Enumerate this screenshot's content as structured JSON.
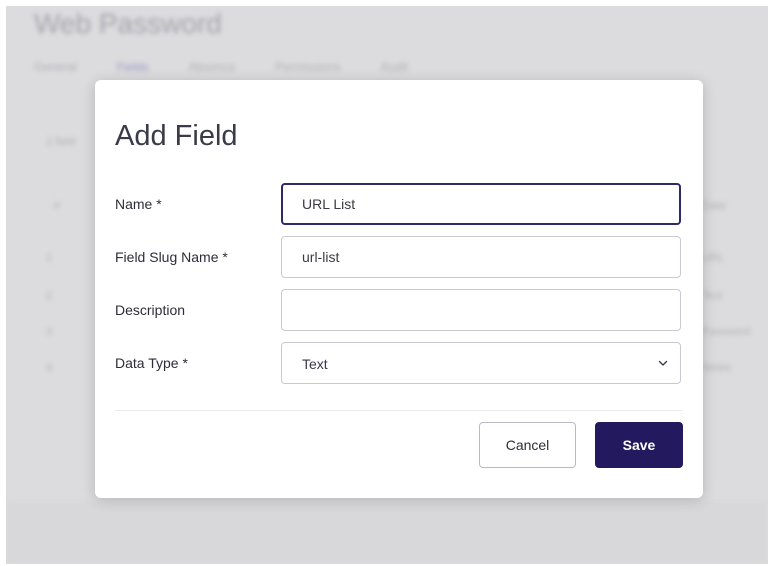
{
  "background": {
    "page_title": "Web Password",
    "tabs": [
      "General",
      "Fields",
      "Absence",
      "Permissions",
      "Audit"
    ],
    "left_text": "1 field",
    "row_numbers": [
      "#",
      "1",
      "2",
      "3",
      "4"
    ],
    "right_header": "Data",
    "right_values": [
      "URL",
      "Text",
      "Password",
      "Notes"
    ]
  },
  "modal": {
    "title": "Add Field",
    "fields": [
      {
        "label": "Name *",
        "value": "URL List",
        "placeholder": ""
      },
      {
        "label": "Field Slug Name *",
        "value": "url-list",
        "placeholder": ""
      },
      {
        "label": "Description",
        "value": "",
        "placeholder": ""
      }
    ],
    "data_type": {
      "label": "Data Type *",
      "selected": "Text"
    },
    "cancel_label": "Cancel",
    "save_label": "Save"
  },
  "colors": {
    "primary": "#23195e",
    "focus_border": "#2c2a6b",
    "overlay": "#dcdcde"
  },
  "icons": {
    "select_arrow": "chevron-down-icon"
  }
}
